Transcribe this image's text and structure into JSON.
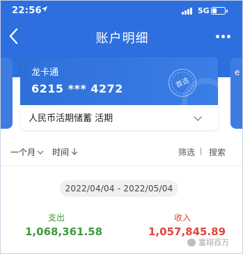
{
  "status_bar": {
    "time": "22:56",
    "network": "5G"
  },
  "nav": {
    "title": "账户明细"
  },
  "card": {
    "name": "龙卡通",
    "number": "6215 *** 4272",
    "badge": "首选",
    "account_type": "人民币活期储蓄 活期"
  },
  "side_card": {
    "peek_text": "e"
  },
  "filters": {
    "month": "一个月",
    "time": "时间",
    "screen": "筛选",
    "separator": "|",
    "search": "搜索"
  },
  "date_range": "2022/04/04 - 2022/05/04",
  "summary": {
    "expense_label": "支出",
    "expense_value": "1,068,361.58",
    "income_label": "收入",
    "income_value": "1,057,845.89"
  },
  "watermark": "富翊百万",
  "colors": {
    "primary_blue": "#2e6fe0",
    "expense_green": "#3f9a3a",
    "income_red": "#e0453c"
  }
}
